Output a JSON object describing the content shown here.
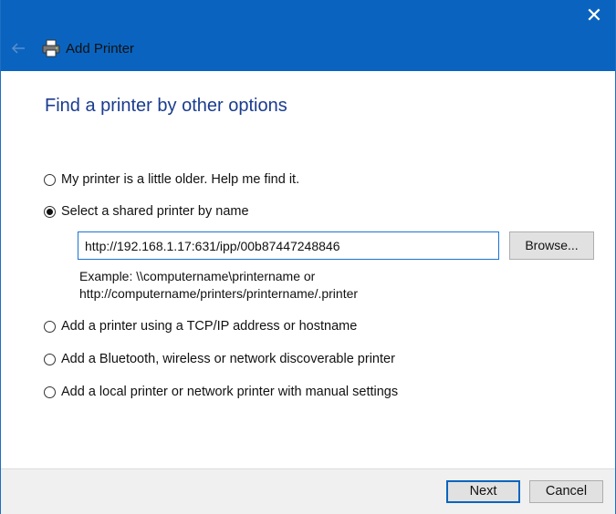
{
  "window": {
    "title": "Add Printer",
    "close_glyph": "✕",
    "back_glyph": "←"
  },
  "page": {
    "heading": "Find a printer by other options"
  },
  "options": [
    {
      "label": "My printer is a little older. Help me find it.",
      "checked": false
    },
    {
      "label": "Select a shared printer by name",
      "checked": true
    },
    {
      "label": "Add a printer using a TCP/IP address or hostname",
      "checked": false
    },
    {
      "label": "Add a Bluetooth, wireless or network discoverable printer",
      "checked": false
    },
    {
      "label": "Add a local printer or network printer with manual settings",
      "checked": false
    }
  ],
  "shared_printer": {
    "value": "http://192.168.1.17:631/ipp/00b87447248846",
    "browse_label": "Browse...",
    "example_line1": "Example: \\\\computername\\printername or",
    "example_line2": "http://computername/printers/printername/.printer"
  },
  "footer": {
    "next_label": "Next",
    "cancel_label": "Cancel"
  },
  "colors": {
    "titlebar": "#0a64bf",
    "heading": "#1a3c8f",
    "input_border": "#1b73d3"
  },
  "icons": {
    "back": "back-arrow-icon",
    "printer": "printer-icon",
    "close": "close-icon"
  }
}
